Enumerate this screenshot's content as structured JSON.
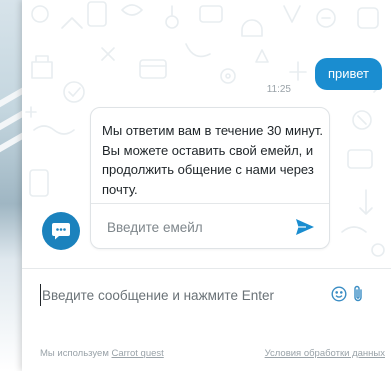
{
  "conversation": {
    "outgoing": {
      "text": "привет",
      "time": "11:25"
    },
    "bot_card": {
      "text": "Мы ответим вам в течение 30 минут. Вы можете оставить свой емейл, и продолжить общение с нами через почту.",
      "email_placeholder": "Введите емейл"
    }
  },
  "composer": {
    "placeholder": "Введите сообщение и нажмите Enter"
  },
  "footer": {
    "prefix": "Мы используем",
    "brand_link": "Carrot quest",
    "terms_link": "Условия обработки данных"
  },
  "icons": {
    "avatar": "chat-bubble-icon",
    "send": "send-icon",
    "emoji": "smile-icon",
    "attach": "paperclip-icon"
  },
  "colors": {
    "accent": "#1a8dd0",
    "avatar": "#1b82bd",
    "pattern": "#e8edf0"
  }
}
